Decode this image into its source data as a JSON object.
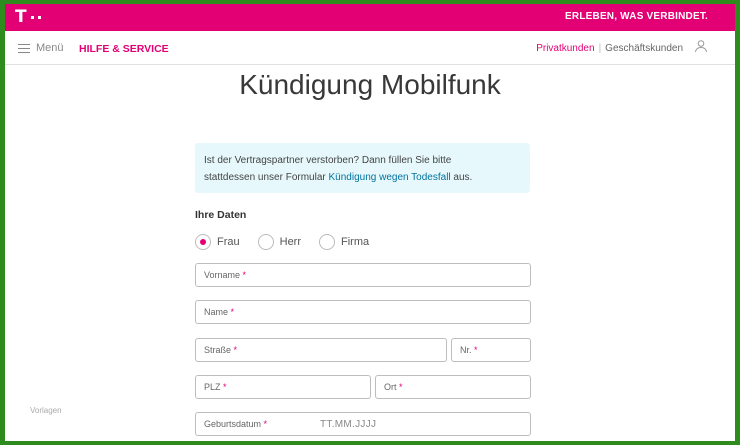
{
  "topbar": {
    "logo_letter": "T",
    "slogan": "ERLEBEN, WAS VERBINDET."
  },
  "nav": {
    "menu_label": "Menü",
    "brand": "HILFE & SERVICE",
    "privatkunden": "Privatkunden",
    "separator": "|",
    "geschaeftskunden": "Geschäftskunden",
    "user_icon": "user-icon"
  },
  "page": {
    "title": "Kündigung Mobilfunk"
  },
  "info": {
    "line1": "Ist der Vertragspartner verstorben? Dann füllen Sie bitte",
    "line2_prefix": "stattdessen unser Formular ",
    "link": "Kündigung wegen Todesfall",
    "line2_suffix": " aus."
  },
  "form": {
    "section_label": "Ihre Daten",
    "salutations": [
      {
        "label": "Frau",
        "checked": true
      },
      {
        "label": "Herr",
        "checked": false
      },
      {
        "label": "Firma",
        "checked": false
      }
    ],
    "fields": {
      "vorname": "Vorname",
      "name": "Name",
      "strasse": "Straße",
      "nr": "Nr.",
      "plz": "PLZ",
      "ort": "Ort",
      "geburtsdatum": "Geburtsdatum",
      "geburtsdatum_mask": "TT.MM.JJJJ",
      "required_mark": "*"
    }
  },
  "footer": {
    "vorlagen": "Vorlagen"
  },
  "colors": {
    "brand_magenta": "#e20074",
    "info_bg": "#e6f8fb",
    "link": "#00739f",
    "frame_green": "#2e8b1e"
  }
}
